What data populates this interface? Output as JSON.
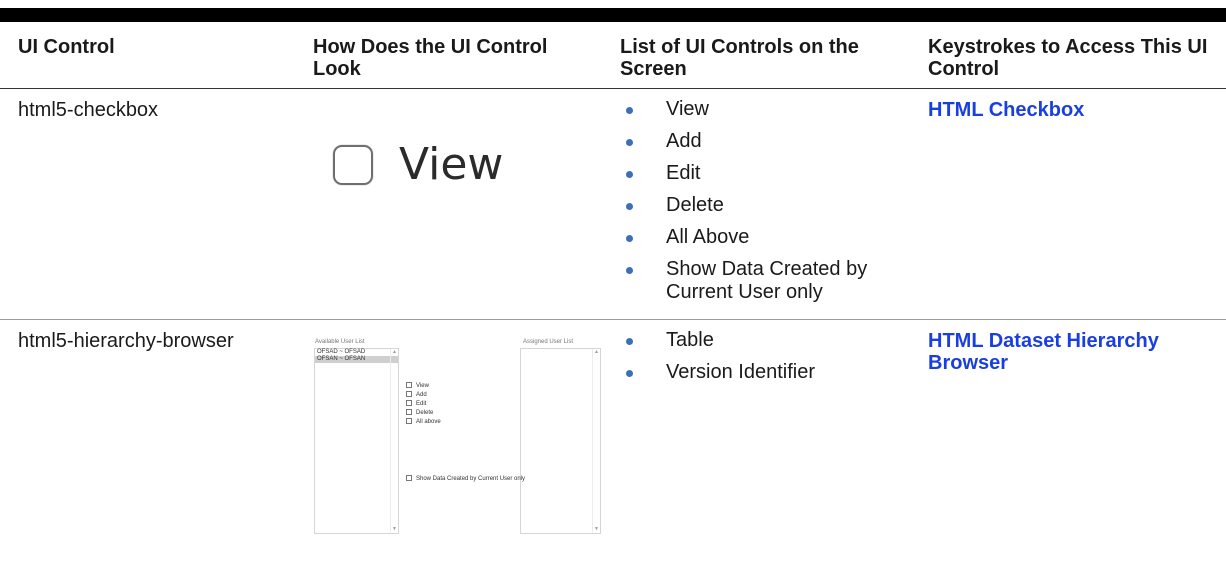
{
  "table": {
    "headers": [
      "UI Control",
      "How Does the UI Control Look",
      "List of UI Controls on the Screen",
      "Keystrokes to Access This UI Control"
    ],
    "rows": [
      {
        "control": "html5-checkbox",
        "preview": {
          "checkbox_label": "View"
        },
        "list": [
          "View",
          "Add",
          "Edit",
          "Delete",
          "All Above",
          "Show Data Created by Current User only"
        ],
        "keystroke_link": "HTML Checkbox"
      },
      {
        "control": "html5-hierarchy-browser",
        "preview": {
          "available_caption": "Available User List",
          "assigned_caption": "Assigned User List",
          "available_items": [
            "OFSAD ~ OFSAD",
            "OFSAN ~ OFSAN"
          ],
          "options": [
            "View",
            "Add",
            "Edit",
            "Delete",
            "All above"
          ],
          "show_data_option": "Show Data Created by Current User only"
        },
        "list": [
          "Table",
          "Version Identifier"
        ],
        "keystroke_link": "HTML Dataset Hierarchy Browser"
      }
    ]
  },
  "colors": {
    "link": "#1a3fe0",
    "bullet": "#3d6fb6",
    "top_bar": "#000000"
  }
}
